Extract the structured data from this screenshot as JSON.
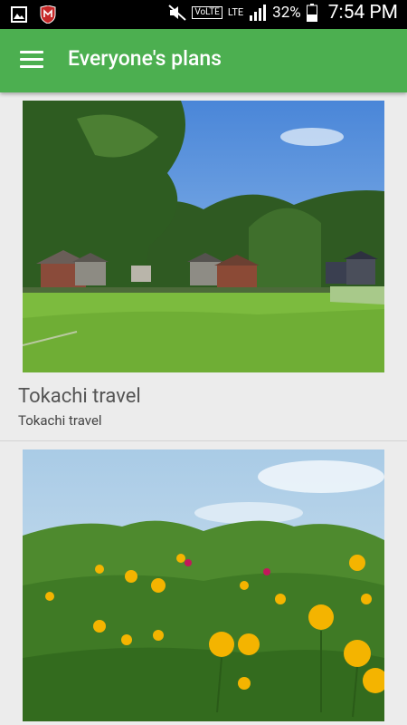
{
  "status_bar": {
    "network_label": "LTE",
    "volte_label": "VoLTE",
    "battery": "32%",
    "time": "7:54 PM"
  },
  "app_bar": {
    "title": "Everyone's plans"
  },
  "plans": [
    {
      "title": "Tokachi travel",
      "subtitle": "Tokachi travel"
    }
  ]
}
